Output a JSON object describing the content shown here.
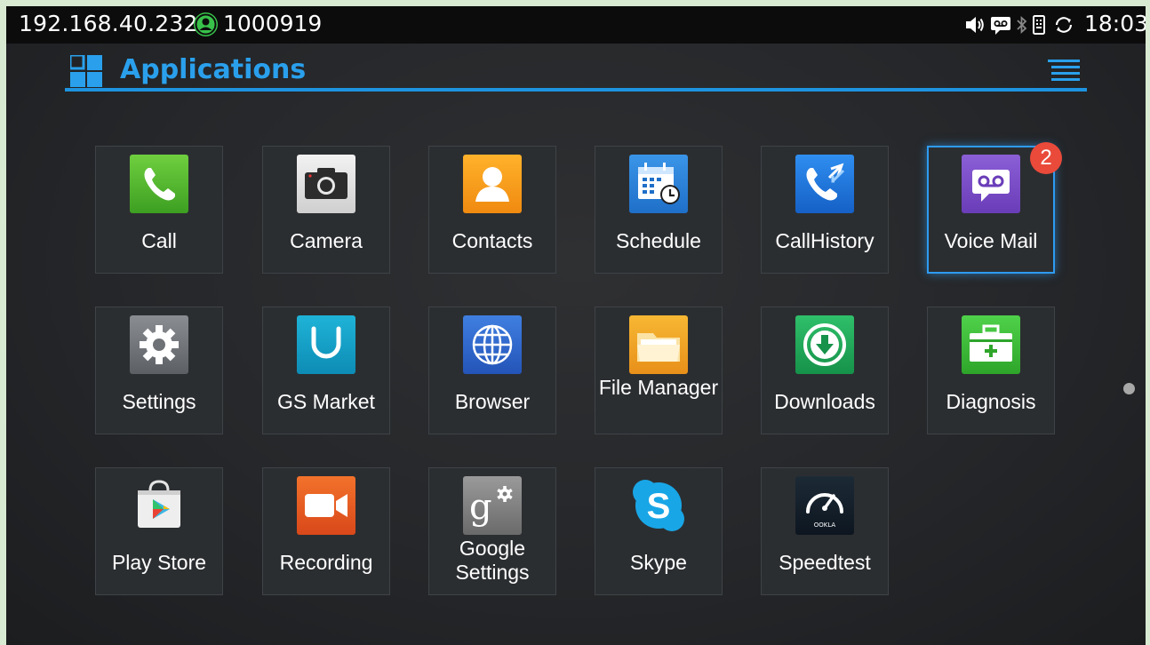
{
  "status_bar": {
    "ip": "192.168.40.232",
    "account": "1000919",
    "time": "18:03",
    "icons": [
      "volume-icon",
      "voicemail-icon",
      "bluetooth-icon",
      "usb-icon",
      "sync-icon"
    ]
  },
  "header": {
    "title": "Applications",
    "accent": "#2aa0ec"
  },
  "apps": [
    {
      "label": "Call",
      "icon": "phone-icon"
    },
    {
      "label": "Camera",
      "icon": "camera-icon"
    },
    {
      "label": "Contacts",
      "icon": "contacts-icon"
    },
    {
      "label": "Schedule",
      "icon": "calendar-icon"
    },
    {
      "label": "CallHistory",
      "icon": "call-history-icon"
    },
    {
      "label": "Voice Mail",
      "icon": "voicemail-icon",
      "badge": "2",
      "selected": true
    },
    {
      "label": "Settings",
      "icon": "gear-icon"
    },
    {
      "label": "GS Market",
      "icon": "market-icon"
    },
    {
      "label": "Browser",
      "icon": "globe-icon"
    },
    {
      "label": "File Manager",
      "icon": "folder-icon"
    },
    {
      "label": "Downloads",
      "icon": "download-icon"
    },
    {
      "label": "Diagnosis",
      "icon": "first-aid-kit-icon"
    },
    {
      "label": "Play Store",
      "icon": "play-store-icon"
    },
    {
      "label": "Recording",
      "icon": "video-camera-icon"
    },
    {
      "label": "Google Settings",
      "icon": "google-settings-icon"
    },
    {
      "label": "Skype",
      "icon": "skype-icon"
    },
    {
      "label": "Speedtest",
      "icon": "speedometer-icon"
    }
  ],
  "pager": {
    "pages": 1,
    "current": 1
  }
}
